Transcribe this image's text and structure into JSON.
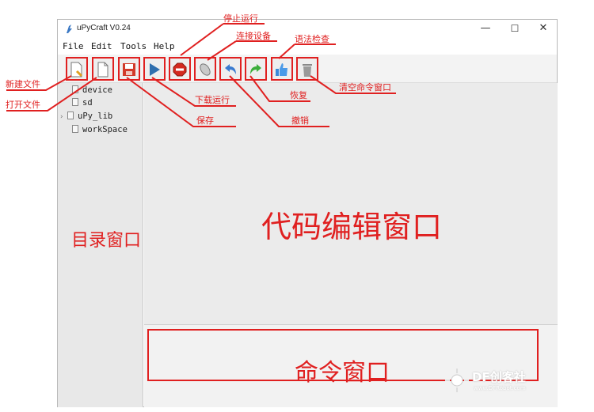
{
  "window": {
    "title": "uPyCraft V0.24",
    "minimize_glyph": "—",
    "maximize_glyph": "☐",
    "close_glyph": "✕"
  },
  "menu": [
    "File",
    "Edit",
    "Tools",
    "Help"
  ],
  "toolbar": [
    {
      "icon": "new-file-icon"
    },
    {
      "icon": "open-file-icon"
    },
    {
      "icon": "save-icon"
    },
    {
      "icon": "download-run-icon"
    },
    {
      "icon": "stop-icon"
    },
    {
      "icon": "connect-icon"
    },
    {
      "icon": "undo-icon"
    },
    {
      "icon": "redo-icon"
    },
    {
      "icon": "syntax-check-icon"
    },
    {
      "icon": "trash-icon"
    }
  ],
  "tree": [
    {
      "label": "device",
      "expandable": false
    },
    {
      "label": "sd",
      "expandable": false
    },
    {
      "label": "uPy_lib",
      "expandable": true,
      "arrow": "›"
    },
    {
      "label": "workSpace",
      "expandable": false
    }
  ],
  "annotations": {
    "new_file": "新建文件",
    "open_file": "打开文件",
    "stop_run": "停止运行",
    "connect": "连接设备",
    "syntax_check": "语法检查",
    "download_run": "下载运行",
    "redo": "恢复",
    "clear_console": "清空命令窗口",
    "save": "保存",
    "undo": "撤销",
    "directory_window": "目录窗口",
    "code_editor_window": "代码编辑窗口",
    "command_window": "命令窗口"
  },
  "watermark": {
    "title": "DF创客社",
    "url": "www.DFRobot.com"
  },
  "colors": {
    "annotation_red": "#e02020",
    "sidebar_bg": "#e8e8e8",
    "editor_bg": "#ebebeb"
  }
}
